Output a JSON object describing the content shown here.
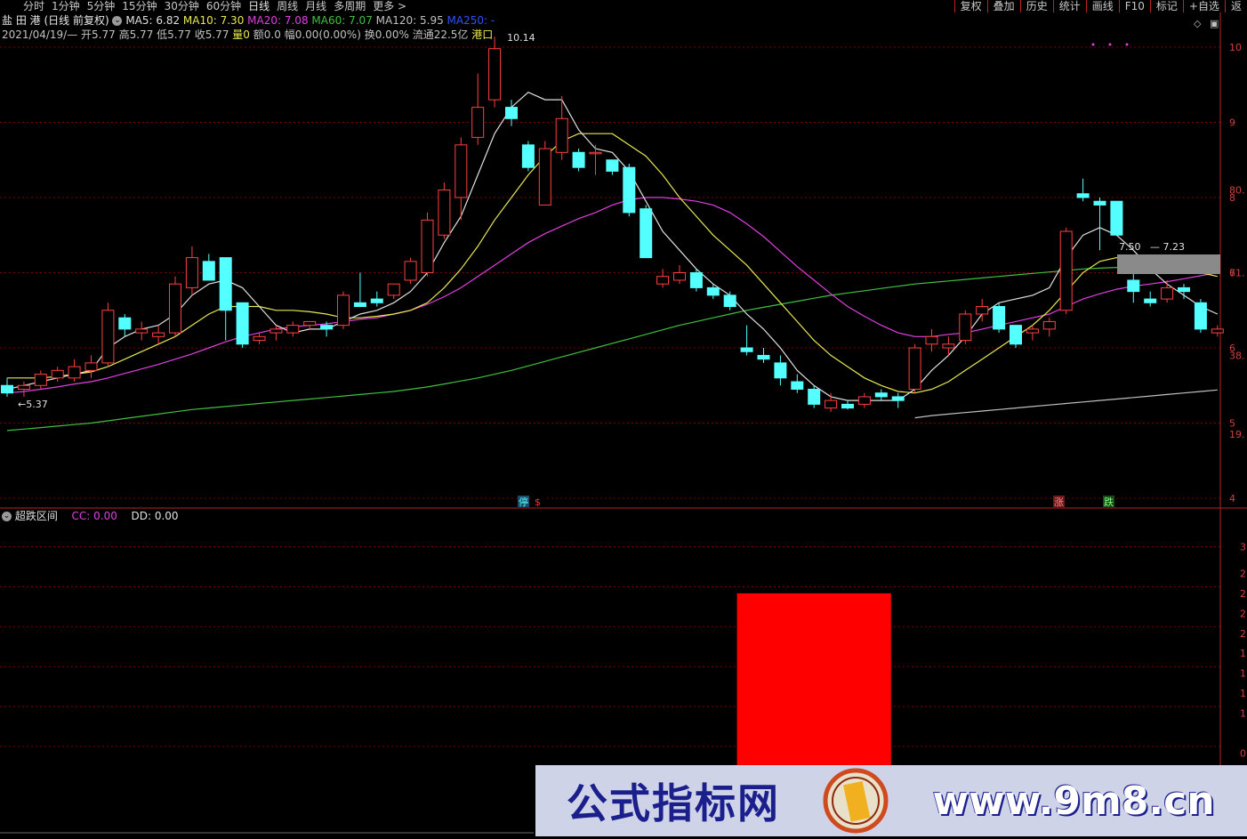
{
  "tabs": [
    "分时",
    "1分钟",
    "5分钟",
    "15分钟",
    "30分钟",
    "60分钟",
    "日线",
    "周线",
    "月线",
    "多周期",
    "更多"
  ],
  "active_tab": "日线",
  "right_buttons": [
    "复权",
    "叠加",
    "历史",
    "统计",
    "画线",
    "F10",
    "标记",
    "+自选",
    "返"
  ],
  "info": {
    "stock_name": "盐 田 港",
    "mode": "(日线 前复权)",
    "ma5": "MA5: 6.82",
    "ma10": "MA10: 7.30",
    "ma20": "MA20: 7.08",
    "ma60": "MA60: 7.07",
    "ma120": "MA120: 5.95",
    "ma250": "MA250: -",
    "date": "2021/04/19/—",
    "open": "开5.77",
    "high": "高5.77",
    "low": "低5.77",
    "close": "收5.77",
    "volume": "量0",
    "amount": "额0.0",
    "range": "幅0.00(0.00%)",
    "turnover": "换0.00%",
    "float": "流通22.5亿",
    "sector": "港口"
  },
  "colors": {
    "ma5": "#e0e0e0",
    "ma10": "#e8e850",
    "ma20": "#e040e0",
    "ma60": "#40c040",
    "ma120": "#c0c0c0",
    "ma250": "#3050ff",
    "up": "#ff4040",
    "down": "#54ffff",
    "grid": "#7a0000"
  },
  "price_labels": {
    "high": "10.14",
    "low": "5.37",
    "recent_a": "7.50",
    "recent_b": "7.23"
  },
  "y_axis_labels": [
    "10",
    "9",
    "8",
    "7",
    "6",
    "5",
    "4"
  ],
  "y_axis_secondary": [
    "80.",
    "61.",
    "38.",
    "19."
  ],
  "markers": {
    "stop": "停",
    "s": "$",
    "rise": "涨",
    "fall": "跌"
  },
  "indicator": {
    "title": "超跌区间",
    "cc": "CC: 0.00",
    "dd": "DD: 0.00"
  },
  "sub_y_axis_labels": [
    "3",
    "2",
    "2",
    "2",
    "2",
    "1",
    "1",
    "1",
    "1",
    "0"
  ],
  "watermark": {
    "left_text": "公式指标网",
    "right_text": "www.9m8.cn",
    "badge_text": "www.9m8.cn"
  },
  "chart_data": {
    "type": "candlestick",
    "ylim": [
      4,
      10.4
    ],
    "candles": [
      {
        "o": 5.5,
        "h": 5.6,
        "l": 5.35,
        "c": 5.4
      },
      {
        "o": 5.45,
        "h": 5.55,
        "l": 5.35,
        "c": 5.5
      },
      {
        "o": 5.5,
        "h": 5.7,
        "l": 5.45,
        "c": 5.65
      },
      {
        "o": 5.6,
        "h": 5.75,
        "l": 5.55,
        "c": 5.7
      },
      {
        "o": 5.6,
        "h": 5.85,
        "l": 5.55,
        "c": 5.75
      },
      {
        "o": 5.7,
        "h": 5.9,
        "l": 5.6,
        "c": 5.8
      },
      {
        "o": 5.8,
        "h": 6.6,
        "l": 5.75,
        "c": 6.5
      },
      {
        "o": 6.4,
        "h": 6.45,
        "l": 6.15,
        "c": 6.25
      },
      {
        "o": 6.2,
        "h": 6.35,
        "l": 6.1,
        "c": 6.25
      },
      {
        "o": 6.15,
        "h": 6.3,
        "l": 6.05,
        "c": 6.2
      },
      {
        "o": 6.2,
        "h": 6.95,
        "l": 6.15,
        "c": 6.85
      },
      {
        "o": 6.8,
        "h": 7.35,
        "l": 6.7,
        "c": 7.2
      },
      {
        "o": 7.15,
        "h": 7.25,
        "l": 6.9,
        "c": 6.9
      },
      {
        "o": 7.2,
        "h": 7.2,
        "l": 6.1,
        "c": 6.5
      },
      {
        "o": 6.6,
        "h": 6.6,
        "l": 6.0,
        "c": 6.05
      },
      {
        "o": 6.1,
        "h": 6.2,
        "l": 6.05,
        "c": 6.15
      },
      {
        "o": 6.2,
        "h": 6.3,
        "l": 6.1,
        "c": 6.25
      },
      {
        "o": 6.2,
        "h": 6.35,
        "l": 6.15,
        "c": 6.3
      },
      {
        "o": 6.3,
        "h": 6.35,
        "l": 6.25,
        "c": 6.35
      },
      {
        "o": 6.3,
        "h": 6.35,
        "l": 6.15,
        "c": 6.25
      },
      {
        "o": 6.3,
        "h": 6.75,
        "l": 6.25,
        "c": 6.7
      },
      {
        "o": 6.6,
        "h": 7.0,
        "l": 6.55,
        "c": 6.55
      },
      {
        "o": 6.65,
        "h": 6.75,
        "l": 6.55,
        "c": 6.6
      },
      {
        "o": 6.7,
        "h": 6.85,
        "l": 6.65,
        "c": 6.85
      },
      {
        "o": 6.9,
        "h": 7.2,
        "l": 6.85,
        "c": 7.15
      },
      {
        "o": 7.0,
        "h": 7.8,
        "l": 6.95,
        "c": 7.7
      },
      {
        "o": 7.5,
        "h": 8.2,
        "l": 7.45,
        "c": 8.1
      },
      {
        "o": 8.0,
        "h": 8.8,
        "l": 7.7,
        "c": 8.7
      },
      {
        "o": 8.8,
        "h": 9.65,
        "l": 8.7,
        "c": 9.2
      },
      {
        "o": 9.3,
        "h": 10.14,
        "l": 9.2,
        "c": 9.98
      },
      {
        "o": 9.2,
        "h": 9.3,
        "l": 8.95,
        "c": 9.05
      },
      {
        "o": 8.7,
        "h": 8.75,
        "l": 8.35,
        "c": 8.4
      },
      {
        "o": 7.9,
        "h": 8.75,
        "l": 7.9,
        "c": 8.65
      },
      {
        "o": 8.6,
        "h": 9.35,
        "l": 8.5,
        "c": 9.05
      },
      {
        "o": 8.6,
        "h": 8.65,
        "l": 8.35,
        "c": 8.4
      },
      {
        "o": 8.6,
        "h": 8.7,
        "l": 8.3,
        "c": 8.6
      },
      {
        "o": 8.5,
        "h": 8.5,
        "l": 8.3,
        "c": 8.35
      },
      {
        "o": 8.4,
        "h": 8.45,
        "l": 7.75,
        "c": 7.8
      },
      {
        "o": 7.85,
        "h": 7.9,
        "l": 7.2,
        "c": 7.2
      },
      {
        "o": 6.85,
        "h": 7.05,
        "l": 6.8,
        "c": 6.95
      },
      {
        "o": 6.9,
        "h": 7.1,
        "l": 6.85,
        "c": 7.0
      },
      {
        "o": 7.0,
        "h": 7.05,
        "l": 6.75,
        "c": 6.8
      },
      {
        "o": 6.8,
        "h": 6.85,
        "l": 6.65,
        "c": 6.7
      },
      {
        "o": 6.7,
        "h": 6.75,
        "l": 6.5,
        "c": 6.55
      },
      {
        "o": 6.0,
        "h": 6.3,
        "l": 5.9,
        "c": 5.95
      },
      {
        "o": 5.9,
        "h": 6.0,
        "l": 5.8,
        "c": 5.85
      },
      {
        "o": 5.8,
        "h": 5.9,
        "l": 5.5,
        "c": 5.6
      },
      {
        "o": 5.55,
        "h": 5.65,
        "l": 5.4,
        "c": 5.45
      },
      {
        "o": 5.45,
        "h": 5.5,
        "l": 5.2,
        "c": 5.25
      },
      {
        "o": 5.2,
        "h": 5.4,
        "l": 5.15,
        "c": 5.3
      },
      {
        "o": 5.25,
        "h": 5.3,
        "l": 5.18,
        "c": 5.2
      },
      {
        "o": 5.25,
        "h": 5.4,
        "l": 5.2,
        "c": 5.35
      },
      {
        "o": 5.4,
        "h": 5.45,
        "l": 5.3,
        "c": 5.35
      },
      {
        "o": 5.35,
        "h": 5.4,
        "l": 5.2,
        "c": 5.3
      },
      {
        "o": 5.45,
        "h": 6.05,
        "l": 5.4,
        "c": 6.0
      },
      {
        "o": 6.05,
        "h": 6.25,
        "l": 5.95,
        "c": 6.15
      },
      {
        "o": 6.0,
        "h": 6.15,
        "l": 5.9,
        "c": 6.05
      },
      {
        "o": 6.1,
        "h": 6.5,
        "l": 6.05,
        "c": 6.45
      },
      {
        "o": 6.45,
        "h": 6.65,
        "l": 6.35,
        "c": 6.55
      },
      {
        "o": 6.55,
        "h": 6.6,
        "l": 6.2,
        "c": 6.25
      },
      {
        "o": 6.3,
        "h": 6.3,
        "l": 6.0,
        "c": 6.05
      },
      {
        "o": 6.2,
        "h": 6.3,
        "l": 6.1,
        "c": 6.25
      },
      {
        "o": 6.25,
        "h": 6.4,
        "l": 6.15,
        "c": 6.35
      },
      {
        "o": 6.5,
        "h": 7.6,
        "l": 6.45,
        "c": 7.55
      },
      {
        "o": 8.05,
        "h": 8.25,
        "l": 7.95,
        "c": 8.0
      },
      {
        "o": 7.95,
        "h": 8.0,
        "l": 7.3,
        "c": 7.9
      },
      {
        "o": 7.95,
        "h": 7.95,
        "l": 7.5,
        "c": 7.5
      },
      {
        "o": 6.9,
        "h": 7.0,
        "l": 6.6,
        "c": 6.75
      },
      {
        "o": 6.65,
        "h": 6.75,
        "l": 6.55,
        "c": 6.6
      },
      {
        "o": 6.65,
        "h": 6.9,
        "l": 6.6,
        "c": 6.8
      },
      {
        "o": 6.8,
        "h": 6.85,
        "l": 6.65,
        "c": 6.75
      },
      {
        "o": 6.6,
        "h": 6.65,
        "l": 6.2,
        "c": 6.25
      },
      {
        "o": 6.2,
        "h": 6.3,
        "l": 6.15,
        "c": 6.25
      }
    ],
    "ma5": [
      5.45,
      5.5,
      5.55,
      5.6,
      5.65,
      5.7,
      6.0,
      6.15,
      6.25,
      6.3,
      6.45,
      6.7,
      6.85,
      6.9,
      6.8,
      6.55,
      6.3,
      6.2,
      6.25,
      6.25,
      6.35,
      6.45,
      6.5,
      6.6,
      6.75,
      7.0,
      7.4,
      7.75,
      8.3,
      8.85,
      9.2,
      9.4,
      9.3,
      9.3,
      8.9,
      8.65,
      8.6,
      8.35,
      7.95,
      7.55,
      7.3,
      7.05,
      6.85,
      6.7,
      6.45,
      6.25,
      6.0,
      5.7,
      5.5,
      5.35,
      5.3,
      5.3,
      5.3,
      5.3,
      5.45,
      5.7,
      5.9,
      6.15,
      6.45,
      6.6,
      6.65,
      6.7,
      6.8,
      7.2,
      7.5,
      7.6,
      7.5,
      7.3,
      7.05,
      6.85,
      6.7,
      6.55,
      6.45
    ],
    "ma10": [
      5.6,
      5.6,
      5.6,
      5.62,
      5.65,
      5.68,
      5.75,
      5.85,
      5.95,
      6.05,
      6.15,
      6.3,
      6.45,
      6.55,
      6.55,
      6.55,
      6.5,
      6.5,
      6.48,
      6.45,
      6.4,
      6.4,
      6.42,
      6.45,
      6.5,
      6.6,
      6.8,
      7.05,
      7.35,
      7.7,
      8.0,
      8.3,
      8.55,
      8.75,
      8.85,
      8.85,
      8.85,
      8.7,
      8.55,
      8.3,
      8.0,
      7.75,
      7.5,
      7.3,
      7.1,
      6.85,
      6.6,
      6.35,
      6.1,
      5.9,
      5.75,
      5.6,
      5.5,
      5.42,
      5.4,
      5.45,
      5.55,
      5.7,
      5.85,
      6.0,
      6.15,
      6.3,
      6.5,
      6.75,
      7.0,
      7.15,
      7.2,
      7.2,
      7.15,
      7.1,
      7.05,
      7.0,
      6.95
    ],
    "ma20": [
      5.4,
      5.42,
      5.45,
      5.48,
      5.52,
      5.55,
      5.6,
      5.66,
      5.72,
      5.78,
      5.85,
      5.92,
      6.0,
      6.08,
      6.15,
      6.2,
      6.25,
      6.28,
      6.3,
      6.32,
      6.35,
      6.38,
      6.4,
      6.45,
      6.5,
      6.58,
      6.68,
      6.8,
      6.95,
      7.1,
      7.25,
      7.4,
      7.52,
      7.62,
      7.72,
      7.8,
      7.9,
      7.97,
      8.0,
      8.0,
      7.98,
      7.95,
      7.9,
      7.8,
      7.65,
      7.48,
      7.28,
      7.08,
      6.9,
      6.72,
      6.55,
      6.42,
      6.3,
      6.2,
      6.15,
      6.15,
      6.18,
      6.2,
      6.25,
      6.3,
      6.35,
      6.4,
      6.45,
      6.55,
      6.65,
      6.72,
      6.78,
      6.82,
      6.85,
      6.88,
      6.92,
      6.96,
      7.0
    ],
    "ma60": [
      4.9,
      4.92,
      4.94,
      4.96,
      4.98,
      5.0,
      5.03,
      5.06,
      5.09,
      5.12,
      5.15,
      5.18,
      5.2,
      5.22,
      5.24,
      5.26,
      5.28,
      5.3,
      5.32,
      5.34,
      5.36,
      5.38,
      5.4,
      5.42,
      5.45,
      5.48,
      5.52,
      5.56,
      5.6,
      5.65,
      5.7,
      5.76,
      5.82,
      5.88,
      5.94,
      6.0,
      6.06,
      6.12,
      6.18,
      6.24,
      6.3,
      6.35,
      6.4,
      6.45,
      6.5,
      6.54,
      6.58,
      6.62,
      6.66,
      6.7,
      6.73,
      6.76,
      6.79,
      6.82,
      6.85,
      6.87,
      6.89,
      6.91,
      6.93,
      6.95,
      6.97,
      6.99,
      7.01,
      7.03,
      7.05,
      7.06,
      7.07,
      7.08,
      7.09,
      7.1,
      7.1,
      7.1,
      7.1
    ],
    "ma120": [
      null,
      null,
      null,
      null,
      null,
      null,
      null,
      null,
      null,
      null,
      null,
      null,
      null,
      null,
      null,
      null,
      null,
      null,
      null,
      null,
      null,
      null,
      null,
      null,
      null,
      null,
      null,
      null,
      null,
      null,
      null,
      null,
      null,
      null,
      null,
      null,
      null,
      null,
      null,
      null,
      null,
      null,
      null,
      null,
      null,
      null,
      null,
      null,
      null,
      null,
      null,
      null,
      null,
      null,
      5.07,
      5.1,
      5.12,
      5.14,
      5.16,
      5.18,
      5.2,
      5.22,
      5.24,
      5.26,
      5.28,
      5.3,
      5.32,
      5.34,
      5.36,
      5.38,
      5.4,
      5.42,
      5.44
    ],
    "sub_indicator": {
      "ylim": [
        0,
        3.5
      ],
      "bars": [
        {
          "start": 44,
          "end": 52,
          "value": 2.5
        }
      ]
    }
  }
}
